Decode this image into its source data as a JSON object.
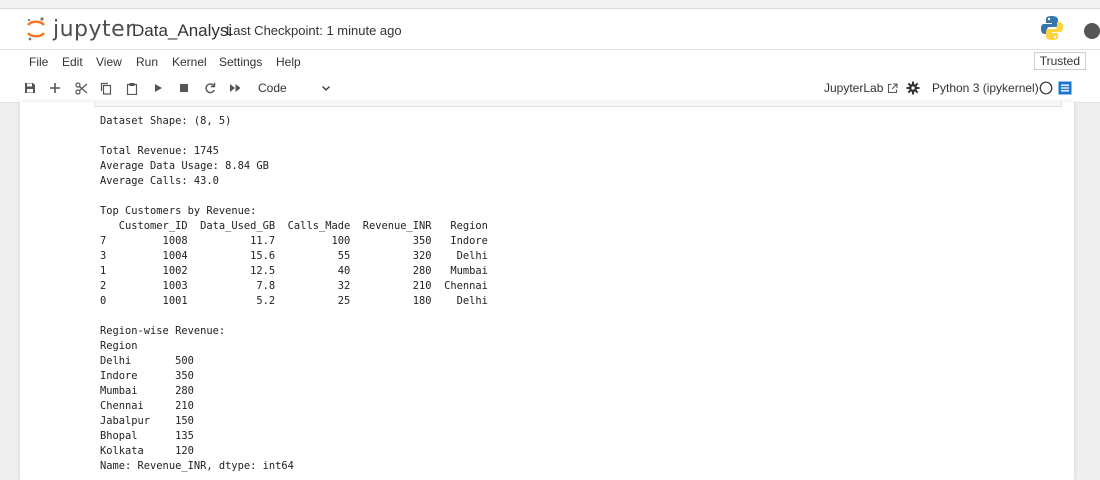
{
  "header": {
    "logo_text": "jupyter",
    "notebook_title": "Data_Analysi",
    "checkpoint": "Last Checkpoint: 1 minute ago",
    "icons": [
      "jupyter-logo-icon",
      "python-logo-icon",
      "user-icon"
    ]
  },
  "menu": {
    "items": [
      "File",
      "Edit",
      "View",
      "Run",
      "Kernel",
      "Settings",
      "Help"
    ],
    "trusted": "Trusted"
  },
  "toolbar": {
    "buttons": [
      "save-icon",
      "add-cell-icon",
      "cut-icon",
      "copy-icon",
      "paste-icon",
      "run-icon",
      "stop-icon",
      "restart-icon",
      "fast-forward-icon"
    ],
    "cell_type": "Code",
    "jupyterlab_link": "JupyterLab",
    "kernel": "Python 3 (ipykernel)"
  },
  "output": {
    "lines": [
      "Dataset Shape: (8, 5)",
      "",
      "Total Revenue: 1745",
      "Average Data Usage: 8.84 GB",
      "Average Calls: 43.0",
      "",
      "Top Customers by Revenue:",
      "   Customer_ID  Data_Used_GB  Calls_Made  Revenue_INR   Region",
      "7         1008          11.7         100          350   Indore",
      "3         1004          15.6          55          320    Delhi",
      "1         1002          12.5          40          280   Mumbai",
      "2         1003           7.8          32          210  Chennai",
      "0         1001           5.2          25          180    Delhi",
      "",
      "Region-wise Revenue:",
      "Region",
      "Delhi       500",
      "Indore      350",
      "Mumbai      280",
      "Chennai     210",
      "Jabalpur    150",
      "Bhopal      135",
      "Kolkata     120",
      "Name: Revenue_INR, dtype: int64"
    ]
  },
  "colors": {
    "accent_orange": "#f37726",
    "toc_blue": "#1976d2",
    "python_blue": "#3776ab",
    "python_yellow": "#ffd43b"
  }
}
